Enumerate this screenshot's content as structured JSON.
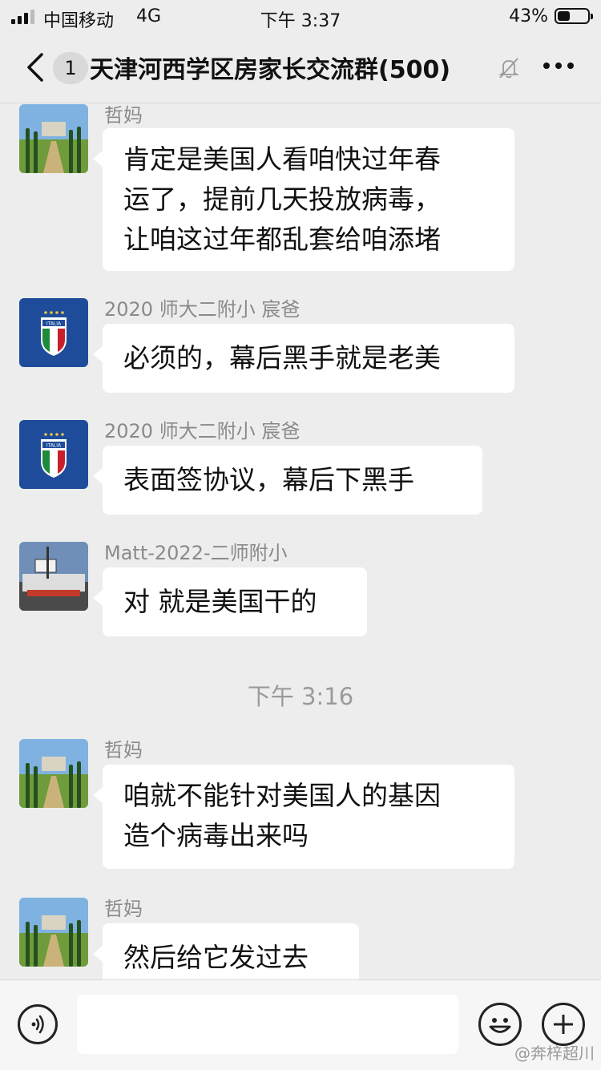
{
  "status_bar": {
    "carrier": "中国移动",
    "network": "4G",
    "time": "下午 3:37",
    "battery": "43%",
    "battery_level": 0.43
  },
  "nav": {
    "unread": "1",
    "title": "天津河西学区房家长交流群(500)"
  },
  "messages": [
    {
      "sender": "哲妈",
      "avatar": "landscape-avatar",
      "lines": [
        "肯定是美国人看咱快过年春",
        "运了，提前几天投放病毒，",
        "让咱这过年都乱套给咱添堵"
      ]
    },
    {
      "sender": "2020 师大二附小 宸爸",
      "avatar": "italia-badge-avatar",
      "lines": [
        "必须的，幕后黑手就是老美"
      ]
    },
    {
      "sender": "2020 师大二附小 宸爸",
      "avatar": "italia-badge-avatar",
      "lines": [
        "表面签协议，幕后下黑手"
      ]
    },
    {
      "sender": "Matt-2022-二师附小",
      "avatar": "street-photo-avatar",
      "lines": [
        "对 就是美国干的"
      ]
    },
    {
      "sender": "哲妈",
      "avatar": "landscape-avatar",
      "lines": [
        "咱就不能针对美国人的基因",
        "造个病毒出来吗"
      ]
    },
    {
      "sender": "哲妈",
      "avatar": "landscape-avatar",
      "lines": [
        "然后给它发过去"
      ]
    }
  ],
  "timestamp": "下午 3:16",
  "avatar_badge_text": "ITALIA",
  "watermark": "@奔梓超川",
  "colors": {
    "background": "#ededed",
    "bubble": "#ffffff",
    "muted_text": "#8a8a8a"
  }
}
